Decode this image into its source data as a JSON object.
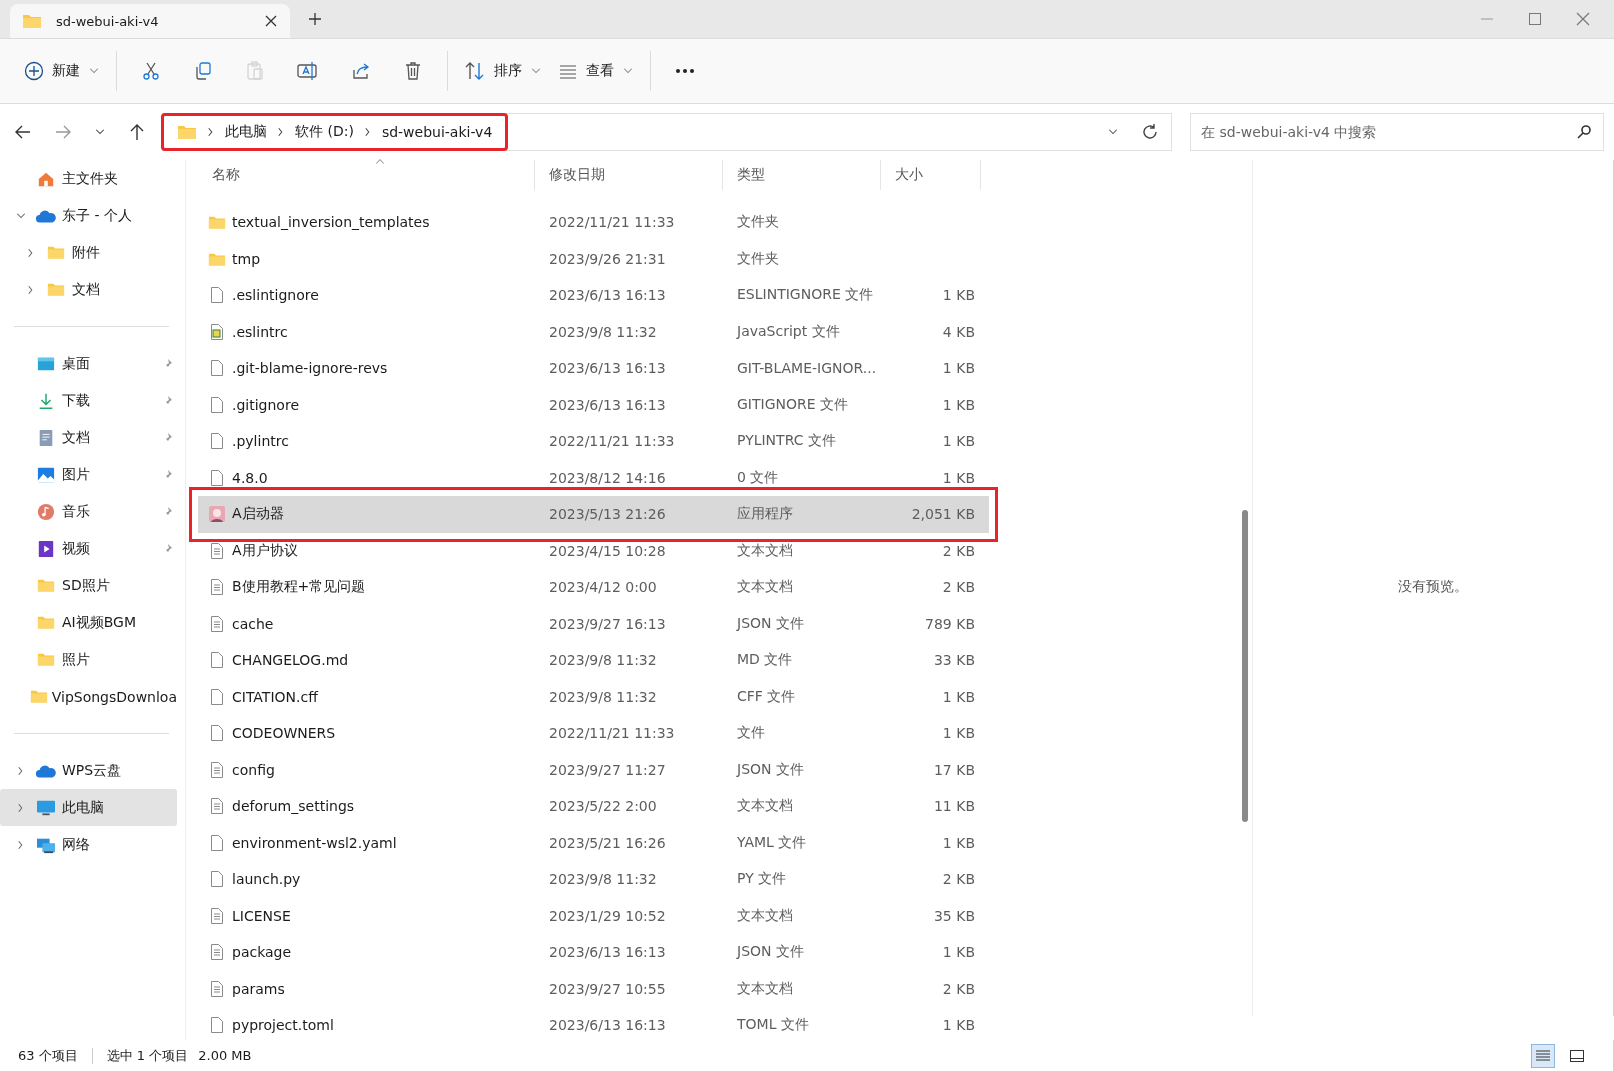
{
  "window": {
    "tab_title": "sd-webui-aki-v4"
  },
  "toolbar": [
    {
      "kind": "new",
      "label": "新建",
      "dropdown": true,
      "disabled": false
    },
    {
      "kind": "cut",
      "disabled": false
    },
    {
      "kind": "copy",
      "disabled": false
    },
    {
      "kind": "paste",
      "disabled": true
    },
    {
      "kind": "rename",
      "disabled": false
    },
    {
      "kind": "share",
      "disabled": false
    },
    {
      "kind": "delete",
      "disabled": false
    },
    {
      "kind": "sort",
      "label": "排序",
      "dropdown": true,
      "disabled": false
    },
    {
      "kind": "view",
      "label": "查看",
      "dropdown": true,
      "disabled": false
    },
    {
      "kind": "more",
      "disabled": false
    }
  ],
  "address": {
    "path": [
      "此电脑",
      "软件 (D:)",
      "sd-webui-aki-v4"
    ],
    "highlighted": true
  },
  "search": {
    "placeholder": "在 sd-webui-aki-v4 中搜索"
  },
  "sidebar": {
    "sections": [
      [
        {
          "label": "主文件夹",
          "kind": "home",
          "selected": false
        },
        {
          "label": "东子 - 个人",
          "kind": "cloud",
          "selected": false,
          "expanded": true,
          "children": [
            {
              "label": "附件",
              "kind": "folder",
              "selected": false,
              "expanded": false
            },
            {
              "label": "文档",
              "kind": "folder",
              "selected": false,
              "expanded": false
            }
          ]
        }
      ],
      [
        {
          "label": "桌面",
          "kind": "desktop",
          "pinned": true,
          "selected": false
        },
        {
          "label": "下载",
          "kind": "download",
          "pinned": true,
          "selected": false
        },
        {
          "label": "文档",
          "kind": "document",
          "pinned": true,
          "selected": false
        },
        {
          "label": "图片",
          "kind": "pictures",
          "pinned": true,
          "selected": false
        },
        {
          "label": "音乐",
          "kind": "music",
          "pinned": true,
          "selected": false
        },
        {
          "label": "视频",
          "kind": "video",
          "pinned": true,
          "selected": false
        },
        {
          "label": "SD照片",
          "kind": "folder",
          "selected": false
        },
        {
          "label": "AI视频BGM",
          "kind": "folder",
          "selected": false
        },
        {
          "label": "照片",
          "kind": "folder",
          "selected": false
        },
        {
          "label": "VipSongsDownloa",
          "kind": "folder",
          "selected": false
        }
      ],
      [
        {
          "label": "WPS云盘",
          "kind": "cloud",
          "selected": false,
          "expanded": false
        },
        {
          "label": "此电脑",
          "kind": "pc",
          "selected": true,
          "expanded": false
        },
        {
          "label": "网络",
          "kind": "network",
          "selected": false,
          "expanded": false
        }
      ]
    ]
  },
  "table": {
    "columns": [
      "名称",
      "修改日期",
      "类型",
      "大小"
    ],
    "rows": [
      {
        "name": "textual_inversion_templates",
        "date": "2022/11/21 11:33",
        "type": "文件夹",
        "kind": "folder",
        "selected": false,
        "highlighted": false
      },
      {
        "name": "tmp",
        "date": "2023/9/26 21:31",
        "type": "文件夹",
        "kind": "folder",
        "selected": false,
        "highlighted": false
      },
      {
        "name": ".eslintignore",
        "date": "2023/6/13 16:13",
        "type": "ESLINTIGNORE 文件",
        "size": "1 KB",
        "kind": "file",
        "selected": false,
        "highlighted": false
      },
      {
        "name": ".eslintrc",
        "date": "2023/9/8 11:32",
        "type": "JavaScript 文件",
        "size": "4 KB",
        "kind": "script",
        "selected": false,
        "highlighted": false
      },
      {
        "name": ".git-blame-ignore-revs",
        "date": "2023/6/13 16:13",
        "type": "GIT-BLAME-IGNOR...",
        "size": "1 KB",
        "kind": "file",
        "selected": false,
        "highlighted": false
      },
      {
        "name": ".gitignore",
        "date": "2023/6/13 16:13",
        "type": "GITIGNORE 文件",
        "size": "1 KB",
        "kind": "file",
        "selected": false,
        "highlighted": false
      },
      {
        "name": ".pylintrc",
        "date": "2022/11/21 11:33",
        "type": "PYLINTRC 文件",
        "size": "1 KB",
        "kind": "file",
        "selected": false,
        "highlighted": false
      },
      {
        "name": "4.8.0",
        "date": "2023/8/12 14:16",
        "type": "0 文件",
        "size": "1 KB",
        "kind": "file",
        "selected": false,
        "highlighted": false
      },
      {
        "name": "A启动器",
        "date": "2023/5/13 21:26",
        "type": "应用程序",
        "size": "2,051 KB",
        "kind": "app",
        "selected": true,
        "highlighted": true
      },
      {
        "name": "A用户协议",
        "date": "2023/4/15 10:28",
        "type": "文本文档",
        "size": "2 KB",
        "kind": "text",
        "selected": false,
        "highlighted": false
      },
      {
        "name": "B使用教程+常见问题",
        "date": "2023/4/12 0:00",
        "type": "文本文档",
        "size": "2 KB",
        "kind": "text",
        "selected": false,
        "highlighted": false
      },
      {
        "name": "cache",
        "date": "2023/9/27 16:13",
        "type": "JSON 文件",
        "size": "789 KB",
        "kind": "text",
        "selected": false,
        "highlighted": false
      },
      {
        "name": "CHANGELOG.md",
        "date": "2023/9/8 11:32",
        "type": "MD 文件",
        "size": "33 KB",
        "kind": "file",
        "selected": false,
        "highlighted": false
      },
      {
        "name": "CITATION.cff",
        "date": "2023/9/8 11:32",
        "type": "CFF 文件",
        "size": "1 KB",
        "kind": "file",
        "selected": false,
        "highlighted": false
      },
      {
        "name": "CODEOWNERS",
        "date": "2022/11/21 11:33",
        "type": "文件",
        "size": "1 KB",
        "kind": "file",
        "selected": false,
        "highlighted": false
      },
      {
        "name": "config",
        "date": "2023/9/27 11:27",
        "type": "JSON 文件",
        "size": "17 KB",
        "kind": "text",
        "selected": false,
        "highlighted": false
      },
      {
        "name": "deforum_settings",
        "date": "2023/5/22 2:00",
        "type": "文本文档",
        "size": "11 KB",
        "kind": "text",
        "selected": false,
        "highlighted": false
      },
      {
        "name": "environment-wsl2.yaml",
        "date": "2023/5/21 16:26",
        "type": "YAML 文件",
        "size": "1 KB",
        "kind": "file",
        "selected": false,
        "highlighted": false
      },
      {
        "name": "launch.py",
        "date": "2023/9/8 11:32",
        "type": "PY 文件",
        "size": "2 KB",
        "kind": "file",
        "selected": false,
        "highlighted": false
      },
      {
        "name": "LICENSE",
        "date": "2023/1/29 10:52",
        "type": "文本文档",
        "size": "35 KB",
        "kind": "text",
        "selected": false,
        "highlighted": false
      },
      {
        "name": "package",
        "date": "2023/6/13 16:13",
        "type": "JSON 文件",
        "size": "1 KB",
        "kind": "text",
        "selected": false,
        "highlighted": false
      },
      {
        "name": "params",
        "date": "2023/9/27 10:55",
        "type": "文本文档",
        "size": "2 KB",
        "kind": "text",
        "selected": false,
        "highlighted": false
      },
      {
        "name": "pyproject.toml",
        "date": "2023/6/13 16:13",
        "type": "TOML 文件",
        "size": "1 KB",
        "kind": "file",
        "selected": false,
        "highlighted": false
      }
    ]
  },
  "preview": {
    "message": "没有预览。"
  },
  "status_bar": {
    "item_count": "63 个项目",
    "selection": "选中 1 个项目",
    "selection_size": "2.00 MB",
    "views": [
      {
        "kind": "details",
        "selected": true
      },
      {
        "kind": "tiles",
        "selected": false
      }
    ]
  }
}
